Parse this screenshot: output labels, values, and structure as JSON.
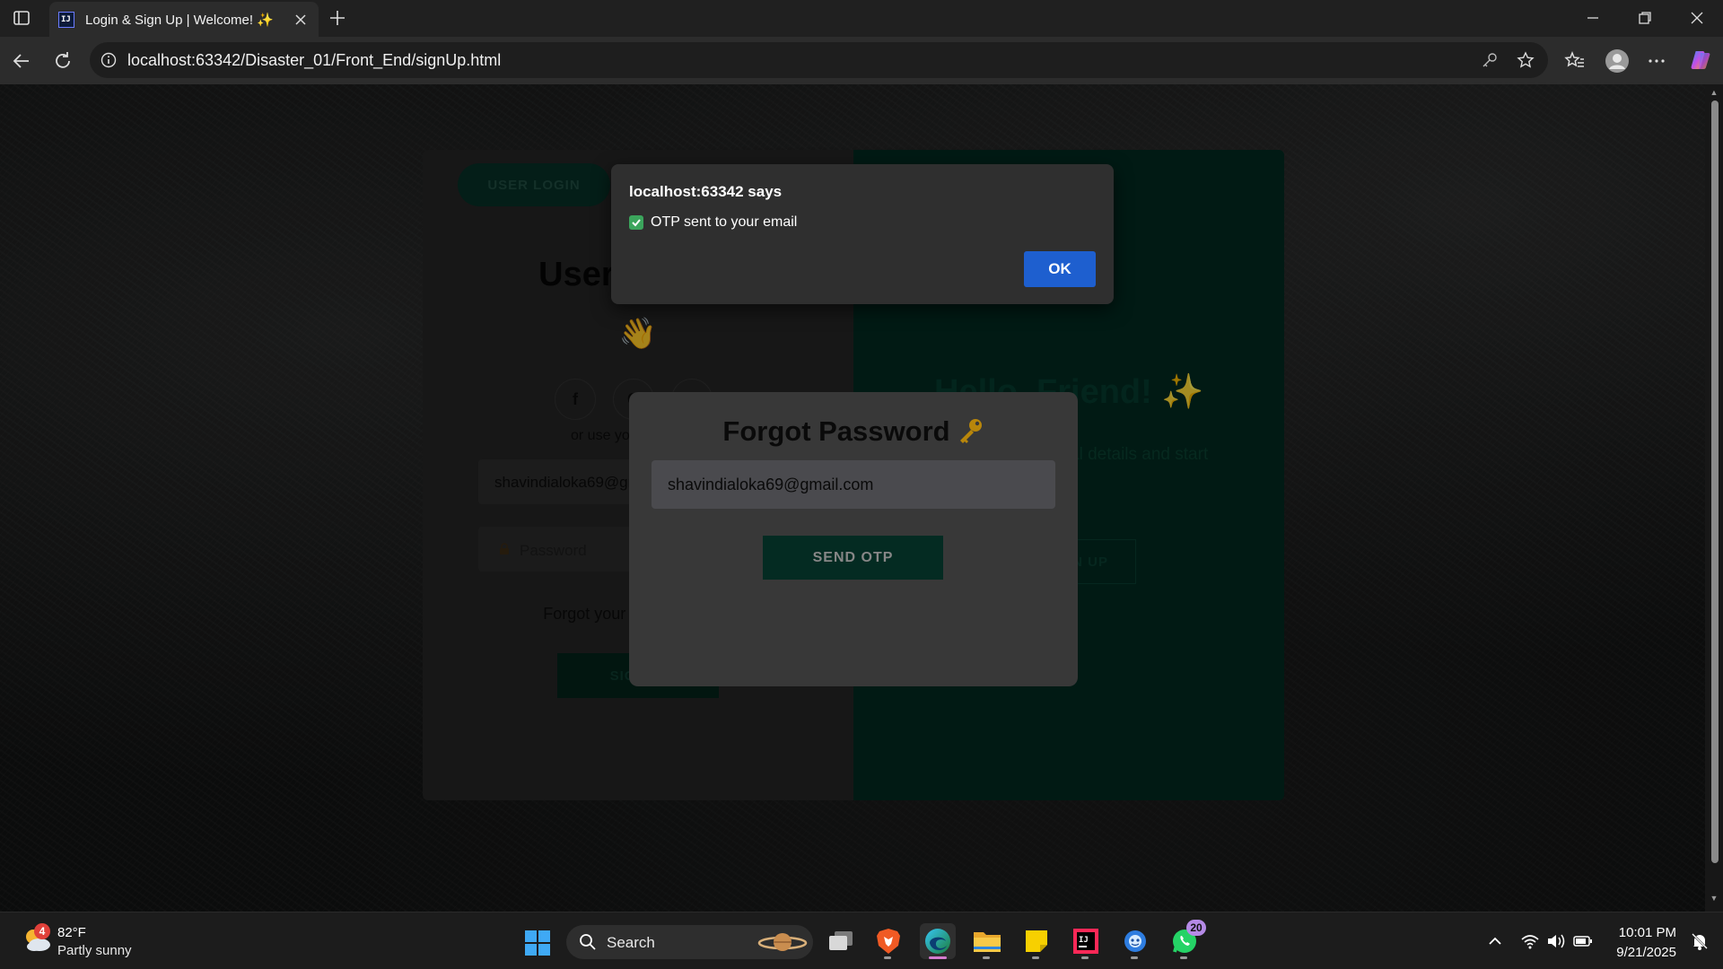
{
  "browser": {
    "tab_title": "Login & Sign Up | Welcome! ✨",
    "url": "localhost:63342/Disaster_01/Front_End/signUp.html"
  },
  "page": {
    "user_login_label": "USER LOGIN",
    "signin_title": "User Sign In",
    "wave_emoji": "👋",
    "social_labels": [
      "f",
      "G",
      "in"
    ],
    "or_text": "or use yo",
    "email_value": "shavindialoka69@gmail.com",
    "password_placeholder": "Password",
    "forgot_link": "Forgot your password? 🤔",
    "signin_button": "SIGN IN",
    "hello_title": "Hello, Friend! ✨",
    "hello_subtitle": "Enter your personal details and start journey with us",
    "signup_button": "SIGN UP"
  },
  "forgot_modal": {
    "title": "Forgot Password",
    "email_value": "shavindialoka69@gmail.com",
    "send_otp_button": "SEND OTP"
  },
  "alert": {
    "title": "localhost:63342 says",
    "message": "OTP sent to your email",
    "ok_button": "OK"
  },
  "taskbar": {
    "weather_badge": "4",
    "weather_temp": "82°F",
    "weather_desc": "Partly sunny",
    "search_label": "Search",
    "whatsapp_badge": "20",
    "time": "10:01 PM",
    "date": "9/21/2025"
  },
  "colors": {
    "accent_green": "#03291f",
    "alert_ok_blue": "#1e5fcf"
  }
}
